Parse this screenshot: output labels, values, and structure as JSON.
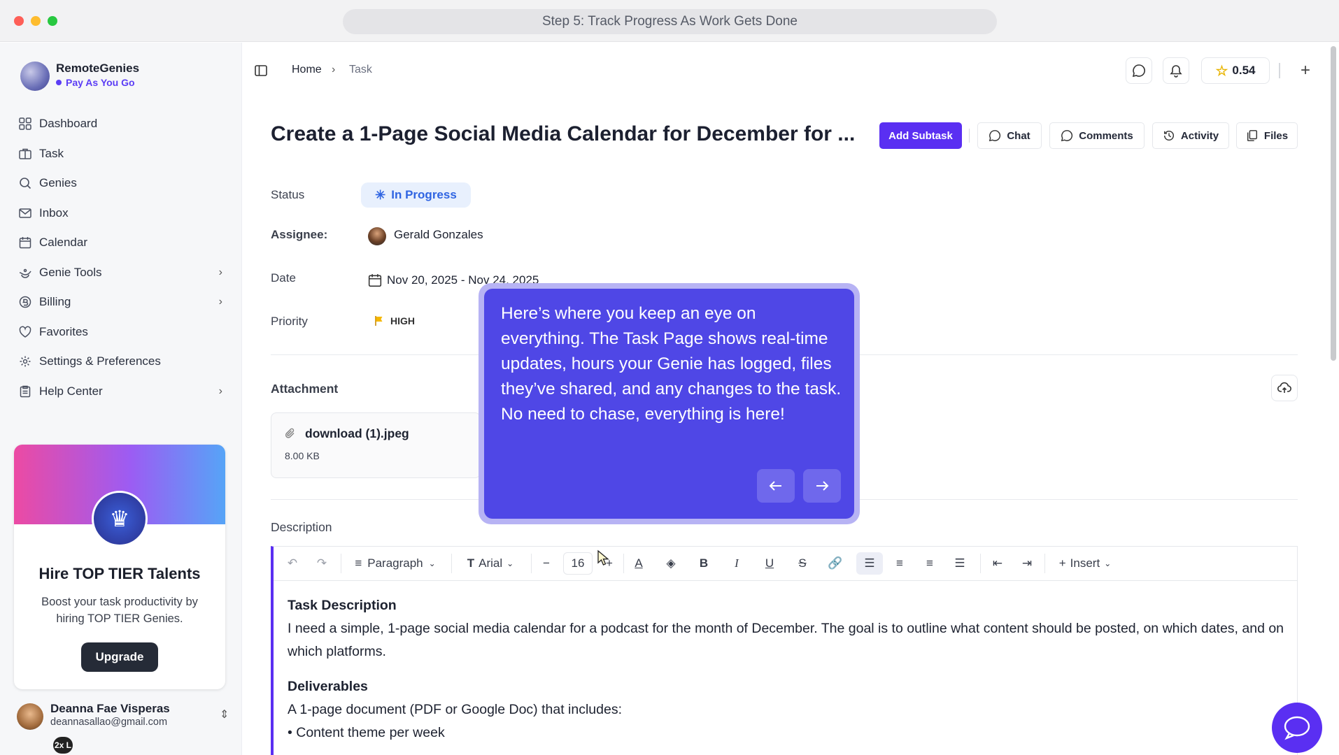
{
  "window": {
    "title": "Step 5: Track Progress As Work Gets Done"
  },
  "brand": {
    "name": "RemoteGenies",
    "plan": "Pay As You Go"
  },
  "sidebar": {
    "items": [
      {
        "label": "Dashboard",
        "icon": "dashboard-icon",
        "has_submenu": false
      },
      {
        "label": "Task",
        "icon": "briefcase-icon",
        "has_submenu": false
      },
      {
        "label": "Genies",
        "icon": "search-icon",
        "has_submenu": false
      },
      {
        "label": "Inbox",
        "icon": "mail-icon",
        "has_submenu": false
      },
      {
        "label": "Calendar",
        "icon": "calendar-icon",
        "has_submenu": false
      },
      {
        "label": "Genie Tools",
        "icon": "lamp-icon",
        "has_submenu": true
      },
      {
        "label": "Billing",
        "icon": "coin-icon",
        "has_submenu": true
      },
      {
        "label": "Favorites",
        "icon": "heart-icon",
        "has_submenu": false
      },
      {
        "label": "Settings & Preferences",
        "icon": "gear-icon",
        "has_submenu": false
      },
      {
        "label": "Help Center",
        "icon": "clipboard-icon",
        "has_submenu": true
      }
    ]
  },
  "promo": {
    "badge": "TOP-TIER",
    "title": "Hire TOP TIER Talents",
    "text": "Boost your task productivity by hiring TOP TIER Genies.",
    "button": "Upgrade"
  },
  "user": {
    "name": "Deanna Fae Visperas",
    "email": "deannasallao@gmail.com",
    "zoom": "2x L"
  },
  "breadcrumb": {
    "home": "Home",
    "current": "Task"
  },
  "topbar": {
    "credits": "0.54"
  },
  "task": {
    "title": "Create a 1-Page Social Media Calendar for December for ...",
    "actions": {
      "add_subtask": "Add Subtask",
      "chat": "Chat",
      "comments": "Comments",
      "activity": "Activity",
      "files": "Files"
    },
    "fields": {
      "status_label": "Status",
      "status_value": "In Progress",
      "assignee_label": "Assignee:",
      "assignee_value": "Gerald Gonzales",
      "date_label": "Date",
      "date_value": "Nov 20, 2025 - Nov 24, 2025",
      "priority_label": "Priority",
      "priority_value": "HIGH"
    },
    "attachment": {
      "label": "Attachment",
      "file_name": "download (1).jpeg",
      "file_size": "8.00 KB"
    },
    "description": {
      "label": "Description",
      "toolbar": {
        "block_type": "Paragraph",
        "font": "Arial",
        "font_size": "16",
        "insert": "Insert"
      },
      "heading1": "Task Description",
      "paragraph1": "I need a simple, 1-page social media calendar for a podcast for the month of December. The goal is to outline what content should be posted, on which dates, and on which platforms.",
      "heading2": "Deliverables",
      "paragraph2": "A 1-page document (PDF or Google Doc) that includes:",
      "bullet1": "• Content theme per week"
    }
  },
  "tour": {
    "text": "Here’s where you keep an eye on everything. The Task Page shows real-time updates, hours your Genie has logged, files they’ve shared, and any changes to the task. No need to chase, everything is here!"
  },
  "colors": {
    "accent": "#5a2ff2",
    "tour_bg": "#4f47e6",
    "status_blue": "#2f64e2"
  }
}
